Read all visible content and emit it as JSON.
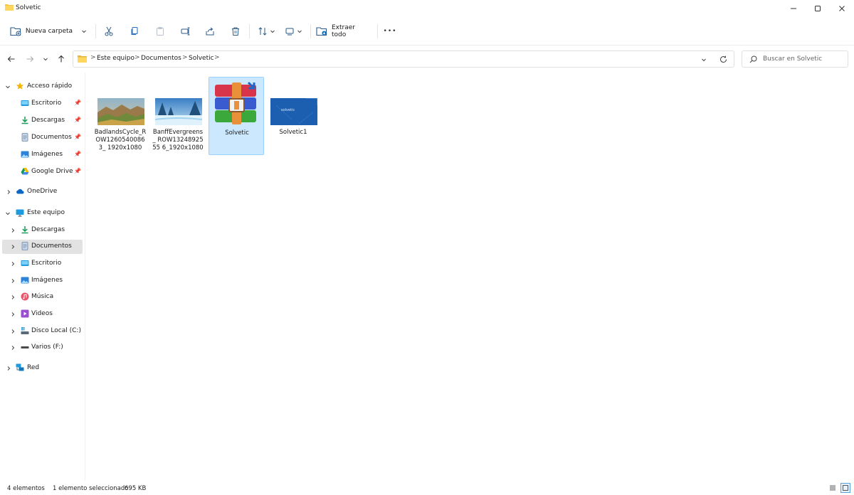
{
  "window": {
    "title": "Solvetic"
  },
  "toolbar": {
    "new_folder_label": "Nueva carpeta",
    "extract_label": "Extraer todo",
    "more_label": "•••"
  },
  "address": {
    "crumbs": [
      "Este equipo",
      "Documentos",
      "Solvetic"
    ],
    "separator": ">"
  },
  "search": {
    "placeholder": "Buscar en Solvetic"
  },
  "sidebar": {
    "quick_access": "Acceso rápido",
    "quick_items": [
      "Escritorio",
      "Descargas",
      "Documentos",
      "Imágenes",
      "Google Drive"
    ],
    "onedrive": "OneDrive",
    "this_pc": "Este equipo",
    "pc_items": [
      "Descargas",
      "Documentos",
      "Escritorio",
      "Imágenes",
      "Música",
      "Videos",
      "Disco Local (C:)",
      "Varios (F:)"
    ],
    "network": "Red",
    "selected": "Documentos"
  },
  "files": [
    {
      "name": "BadlandsCycle_ROW12605400863_1920x1080",
      "display": "BadlandsCycle_R OW12605400863_ 1920x1080"
    },
    {
      "name": "BanffEvergreens_ROW13248925556_1920x1080",
      "display": "BanffEvergreens_ ROW1324892555 6_1920x1080"
    },
    {
      "name": "Solvetic",
      "display": "Solvetic",
      "selected": true
    },
    {
      "name": "Solvetic1",
      "display": "Solvetic1",
      "thumb_text": "solvetic"
    }
  ],
  "status": {
    "count": "4 elementos",
    "selection": "1 elemento seleccionado",
    "size": "695 KB"
  },
  "colors": {
    "accent": "#0067c0",
    "selected_bg": "#cce8ff",
    "folder": "#f4c542"
  }
}
